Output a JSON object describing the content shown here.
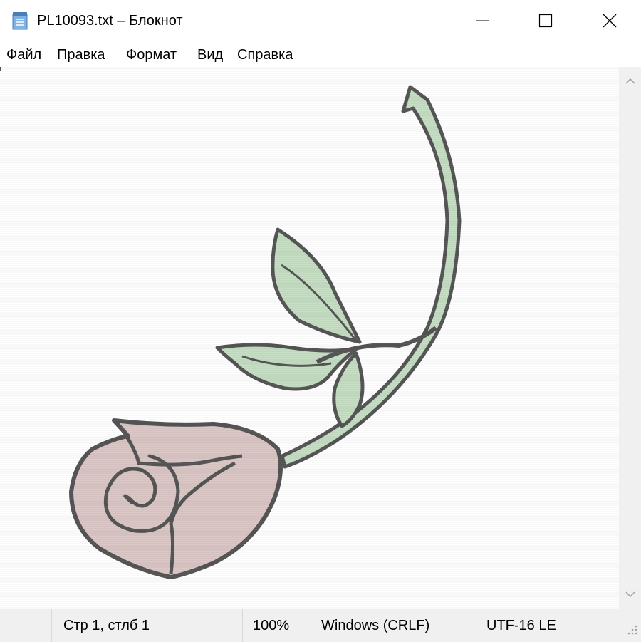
{
  "window": {
    "title": "PL10093.txt – Блокнот",
    "icons": {
      "app": "notepad-icon",
      "minimize": "minimize-icon",
      "maximize": "maximize-icon",
      "close": "close-icon"
    }
  },
  "menu": {
    "items": [
      "Файл",
      "Правка",
      "Формат",
      "Вид",
      "Справка"
    ]
  },
  "editor": {
    "content_description_icon": "rose-ascii-art",
    "colors": {
      "leaf": "#a7cda4",
      "petal": "#c7aaa8",
      "outline": "#000000"
    }
  },
  "statusbar": {
    "position": "Стр 1, стлб 1",
    "zoom": "100%",
    "line_ending": "Windows (CRLF)",
    "encoding": "UTF-16 LE"
  },
  "colors": {
    "chrome": "#f0f0f0",
    "border": "#d9d9d9"
  }
}
